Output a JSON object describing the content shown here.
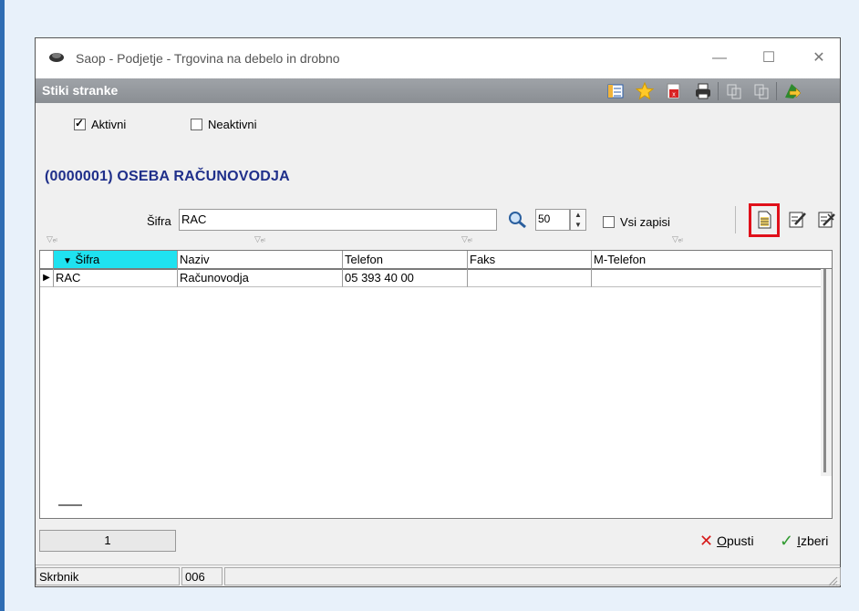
{
  "window": {
    "title": "Saop  - Podjetje - Trgovina na debelo in drobno",
    "section_title": "Stiki stranke",
    "controls": {
      "minimize": "—",
      "maximize": "☐",
      "close": "✕"
    }
  },
  "toolbar_icons": [
    "layout-icon",
    "favorite-star-icon",
    "export-pdf-icon",
    "print-icon",
    "copy-icon",
    "paste-icon",
    "exit-icon"
  ],
  "filters": {
    "aktivni": {
      "label": "Aktivni",
      "checked": true
    },
    "neaktivni": {
      "label": "Neaktivni",
      "checked": false
    }
  },
  "record_heading": "(0000001) OSEBA RAČUNOVODJA",
  "search": {
    "label": "Šifra",
    "value": "RAC",
    "limit": "50",
    "all_records_label": "Vsi zapisi",
    "all_records_checked": false
  },
  "actions": [
    "new-record-icon",
    "edit-record-icon",
    "edit-multi-icon"
  ],
  "grid": {
    "columns": [
      "Šifra",
      "Naziv",
      "Telefon",
      "Faks",
      "M-Telefon"
    ],
    "sort_indicator": "▼",
    "rows": [
      {
        "sifra": "RAC",
        "naziv": "Računovodja",
        "telefon": "05 393 40 00",
        "faks": "",
        "mtelefon": ""
      }
    ]
  },
  "footer": {
    "page": "1",
    "cancel_label_first": "O",
    "cancel_label_rest": "pusti",
    "select_label_first": "I",
    "select_label_rest": "zberi"
  },
  "statusbar": {
    "label": "Skrbnik",
    "code": "006",
    "extra": ""
  },
  "colors": {
    "accent": "#2f6db3",
    "header_strip": "#9fa3a8",
    "heading": "#1f2f8a",
    "sort_column": "#1fe2f0",
    "highlight": "#e0101a"
  }
}
